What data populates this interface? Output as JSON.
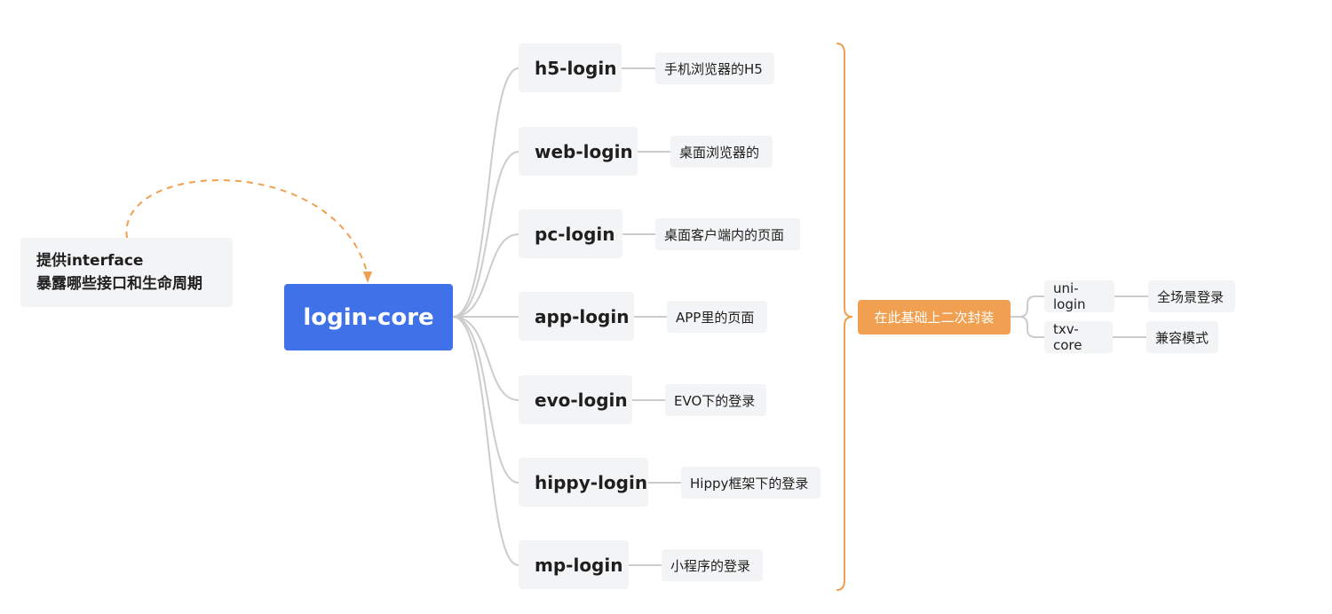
{
  "root": {
    "label": "login-core"
  },
  "note": {
    "line1": "提供interface",
    "line2": "暴露哪些接口和生命周期"
  },
  "branches": [
    {
      "label": "h5-login",
      "desc": "手机浏览器的H5"
    },
    {
      "label": "web-login",
      "desc": "桌面浏览器的"
    },
    {
      "label": "pc-login",
      "desc": "桌面客户端内的页面"
    },
    {
      "label": "app-login",
      "desc": "APP里的页面"
    },
    {
      "label": "evo-login",
      "desc": "EVO下的登录"
    },
    {
      "label": "hippy-login",
      "desc": "Hippy框架下的登录"
    },
    {
      "label": "mp-login",
      "desc": "小程序的登录"
    }
  ],
  "summary": {
    "label": "在此基础上二次封装"
  },
  "derived": [
    {
      "label": "uni-login",
      "desc": "全场景登录"
    },
    {
      "label": "txv-core",
      "desc": "兼容模式"
    }
  ],
  "colors": {
    "root": "#3f72e8",
    "summary": "#f0a050",
    "node_bg": "#f3f4f6",
    "connector": "#cccccc",
    "bracket": "#f0a050"
  }
}
